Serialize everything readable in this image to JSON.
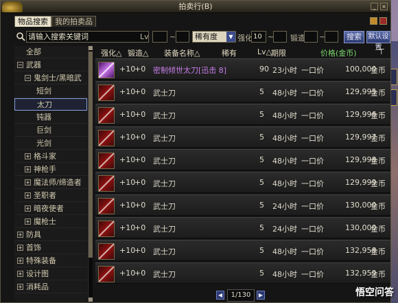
{
  "window": {
    "title": "拍卖行(B)",
    "minimize_icon": "minimize-icon",
    "close_icon": "close-icon"
  },
  "tabs": [
    {
      "label": "物品搜索",
      "active": true
    },
    {
      "label": "我的拍卖品",
      "active": false
    }
  ],
  "search": {
    "value": "请输入搜索关键词",
    "lv_label": "Lv",
    "lv_min": "",
    "lv_sep": "~",
    "lv_max": "",
    "rarity_value": "稀有度",
    "enhance_label": "强化",
    "enhance_value": "10",
    "enhance_sep": "~",
    "enhance_max": "",
    "refine_label": "锻造",
    "refine_min": "",
    "refine_sep": "~",
    "refine_max": "",
    "search_button": "搜索",
    "default_button": "默认设置"
  },
  "sidebar": {
    "items": [
      {
        "label": "全部",
        "level": 0
      },
      {
        "label": "武器",
        "level": 0,
        "expander": "−"
      },
      {
        "label": "鬼剑士/黑暗武",
        "level": 1,
        "expander": "−"
      },
      {
        "label": "短剑",
        "level": 2
      },
      {
        "label": "太刀",
        "level": 2,
        "selected": true
      },
      {
        "label": "钝器",
        "level": 2
      },
      {
        "label": "巨剑",
        "level": 2
      },
      {
        "label": "光剑",
        "level": 2
      },
      {
        "label": "格斗家",
        "level": 1,
        "expander": "+"
      },
      {
        "label": "神枪手",
        "level": 1,
        "expander": "+"
      },
      {
        "label": "魔法师/缔造者",
        "level": 1,
        "expander": "+"
      },
      {
        "label": "圣职者",
        "level": 1,
        "expander": "+"
      },
      {
        "label": "暗夜使者",
        "level": 1,
        "expander": "+"
      },
      {
        "label": "魔枪士",
        "level": 1,
        "expander": "+"
      },
      {
        "label": "防具",
        "level": 0,
        "expander": "+"
      },
      {
        "label": "首饰",
        "level": 0,
        "expander": "+"
      },
      {
        "label": "特殊装备",
        "level": 0,
        "expander": "+"
      },
      {
        "label": "设计图",
        "level": 0,
        "expander": "+"
      },
      {
        "label": "消耗品",
        "level": 0,
        "expander": "+"
      }
    ]
  },
  "columns": {
    "enhance": "强化△",
    "refine": "锻造△",
    "name": "装备名称△",
    "rarity": "稀有",
    "lv": "Lv△",
    "time": "期限",
    "price": "价格(金币)",
    "sort_icon": "sort-icon"
  },
  "rows": [
    {
      "enh": "+10",
      "ref": "+0",
      "name": "密制倾世太刀[迅击 8]",
      "lv": "90",
      "time": "23小时",
      "bid": "一口价",
      "price": "100,000",
      "cur": "金币",
      "rare": true
    },
    {
      "enh": "+10",
      "ref": "+0",
      "name": "武士刀",
      "lv": "5",
      "time": "48小时",
      "bid": "一口价",
      "price": "129,995",
      "cur": "金币"
    },
    {
      "enh": "+10",
      "ref": "+0",
      "name": "武士刀",
      "lv": "5",
      "time": "48小时",
      "bid": "一口价",
      "price": "129,996",
      "cur": "金币"
    },
    {
      "enh": "+10",
      "ref": "+0",
      "name": "武士刀",
      "lv": "5",
      "time": "48小时",
      "bid": "一口价",
      "price": "129,997",
      "cur": "金币"
    },
    {
      "enh": "+10",
      "ref": "+0",
      "name": "武士刀",
      "lv": "5",
      "time": "48小时",
      "bid": "一口价",
      "price": "129,998",
      "cur": "金币"
    },
    {
      "enh": "+10",
      "ref": "+0",
      "name": "武士刀",
      "lv": "5",
      "time": "48小时",
      "bid": "一口价",
      "price": "129,999",
      "cur": "金币"
    },
    {
      "enh": "+10",
      "ref": "+0",
      "name": "武士刀",
      "lv": "5",
      "time": "24小时",
      "bid": "一口价",
      "price": "130,000",
      "cur": "金币"
    },
    {
      "enh": "+10",
      "ref": "+0",
      "name": "武士刀",
      "lv": "5",
      "time": "24小时",
      "bid": "一口价",
      "price": "130,000",
      "cur": "金币"
    },
    {
      "enh": "+10",
      "ref": "+0",
      "name": "武士刀",
      "lv": "5",
      "time": "48小时",
      "bid": "一口价",
      "price": "132,958",
      "cur": "金币"
    },
    {
      "enh": "+10",
      "ref": "+0",
      "name": "武士刀",
      "lv": "5",
      "time": "48小时",
      "bid": "一口价",
      "price": "132,959",
      "cur": "金币"
    }
  ],
  "pager": {
    "text": "1/130",
    "prev_icon": "prev-page-icon",
    "next_icon": "next-page-icon"
  },
  "watermark": "悟空问答",
  "colors": {
    "rare_name": "#c77de9",
    "price_header": "#7ed96e",
    "selected_border": "#8aa0e0"
  }
}
